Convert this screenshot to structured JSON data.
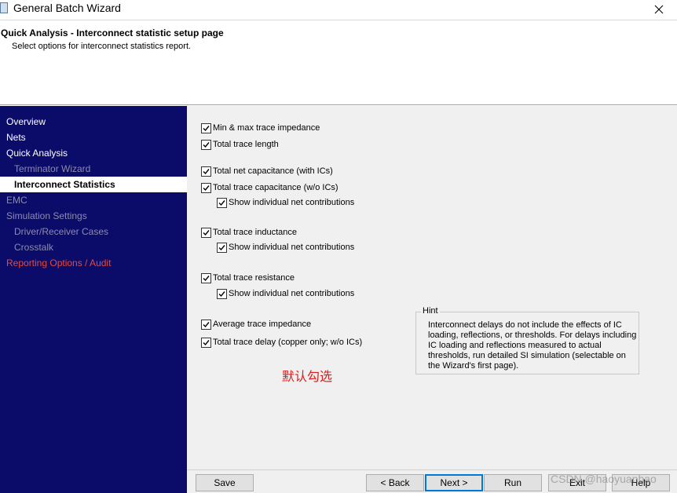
{
  "window": {
    "title": "General Batch Wizard",
    "close_icon": "close-icon"
  },
  "header": {
    "title": "Quick Analysis - Interconnect statistic setup page",
    "subtitle": "Select options for interconnect statistics report."
  },
  "sidebar": {
    "items": [
      {
        "label": "Overview",
        "state": "normal"
      },
      {
        "label": "Nets",
        "state": "normal"
      },
      {
        "label": "Quick Analysis",
        "state": "normal"
      },
      {
        "label": "Terminator Wizard",
        "state": "dim"
      },
      {
        "label": "Interconnect Statistics",
        "state": "selected"
      },
      {
        "label": "EMC",
        "state": "dim"
      },
      {
        "label": "Simulation Settings",
        "state": "dim"
      },
      {
        "label": "Driver/Receiver Cases",
        "state": "dim"
      },
      {
        "label": "Crosstalk",
        "state": "dim"
      },
      {
        "label": "Reporting Options / Audit",
        "state": "red"
      }
    ]
  },
  "options": {
    "min_max_impedance": {
      "label": "Min & max trace impedance",
      "checked": true
    },
    "total_trace_length": {
      "label": "Total trace length",
      "checked": true
    },
    "total_net_capacitance": {
      "label": "Total net capacitance  (with ICs)",
      "checked": true
    },
    "total_trace_capacitance": {
      "label": "Total trace capacitance  (w/o  ICs)",
      "checked": true
    },
    "capacitance_contrib": {
      "label": "Show individual net contributions",
      "checked": true
    },
    "total_trace_inductance": {
      "label": "Total trace inductance",
      "checked": true
    },
    "inductance_contrib": {
      "label": "Show individual net contributions",
      "checked": true
    },
    "total_trace_resistance": {
      "label": "Total trace resistance",
      "checked": true
    },
    "resistance_contrib": {
      "label": "Show individual net contributions",
      "checked": true
    },
    "average_trace_impedance": {
      "label": "Average trace impedance",
      "checked": true
    },
    "total_trace_delay": {
      "label": "Total trace delay (copper only; w/o ICs)",
      "checked": true
    }
  },
  "hint": {
    "title": "Hint",
    "text": "Interconnect delays do not include the effects of IC loading, reflections, or thresholds.  For delays including IC loading and reflections measured to actual thresholds, run detailed SI simulation (selectable on the Wizard's first page)."
  },
  "annotation": "默认勾选",
  "buttons": {
    "save": "Save",
    "back": "< Back",
    "next": "Next >",
    "run": "Run",
    "exit": "Exit",
    "help": "Help"
  },
  "watermark": "CSDN @haoyuanbao",
  "colors": {
    "sidebar_bg": "#0b0b6a",
    "annotation_red": "#d81e1e",
    "reporting_red": "#e84a3a",
    "dim_text": "#8c8caa"
  }
}
